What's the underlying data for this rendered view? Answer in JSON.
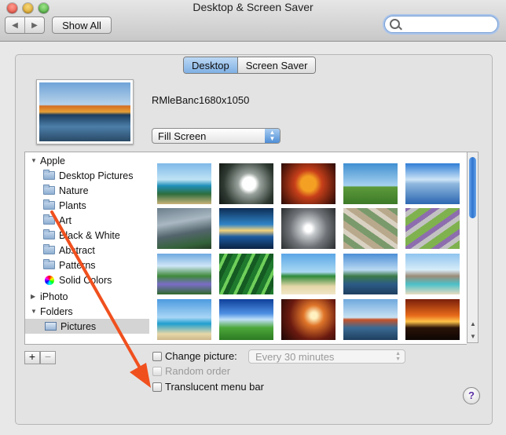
{
  "window": {
    "title": "Desktop & Screen Saver"
  },
  "toolbar": {
    "back_icon": "back-arrow-icon",
    "forward_icon": "forward-arrow-icon",
    "show_all_label": "Show All",
    "search_placeholder": "",
    "search_value": ""
  },
  "tabs": [
    {
      "label": "Desktop",
      "active": true
    },
    {
      "label": "Screen Saver",
      "active": false
    }
  ],
  "current_picture": {
    "name": "RMleBanc1680x1050"
  },
  "fit_mode": {
    "selected": "Fill Screen"
  },
  "sidebar": {
    "items": [
      {
        "label": "Apple",
        "type": "group",
        "expanded": true,
        "icon": "disclosure-down-icon"
      },
      {
        "label": "Desktop Pictures",
        "type": "folder",
        "icon": "folder-icon"
      },
      {
        "label": "Nature",
        "type": "folder",
        "icon": "folder-icon"
      },
      {
        "label": "Plants",
        "type": "folder",
        "icon": "folder-icon"
      },
      {
        "label": "Art",
        "type": "folder",
        "icon": "folder-icon"
      },
      {
        "label": "Black & White",
        "type": "folder",
        "icon": "folder-icon"
      },
      {
        "label": "Abstract",
        "type": "folder",
        "icon": "folder-icon"
      },
      {
        "label": "Patterns",
        "type": "folder",
        "icon": "folder-icon"
      },
      {
        "label": "Solid Colors",
        "type": "folder",
        "icon": "color-wheel-icon"
      },
      {
        "label": "iPhoto",
        "type": "group",
        "expanded": false,
        "icon": "disclosure-right-icon"
      },
      {
        "label": "Folders",
        "type": "group",
        "expanded": true,
        "icon": "disclosure-down-icon"
      },
      {
        "label": "Pictures",
        "type": "folder",
        "icon": "pictures-folder-icon",
        "selected": true
      }
    ],
    "add_label": "+",
    "remove_label": "−"
  },
  "options": {
    "change_picture": {
      "label": "Change picture:",
      "checked": false
    },
    "interval": {
      "selected": "Every 30 minutes",
      "enabled": false
    },
    "random_order": {
      "label": "Random order",
      "checked": false,
      "enabled": false
    },
    "translucent_menu_bar": {
      "label": "Translucent menu bar",
      "checked": false
    }
  },
  "help": {
    "label": "?"
  },
  "colors": {
    "accent": "#2f74cf",
    "annotation_arrow": "#f0501e"
  }
}
